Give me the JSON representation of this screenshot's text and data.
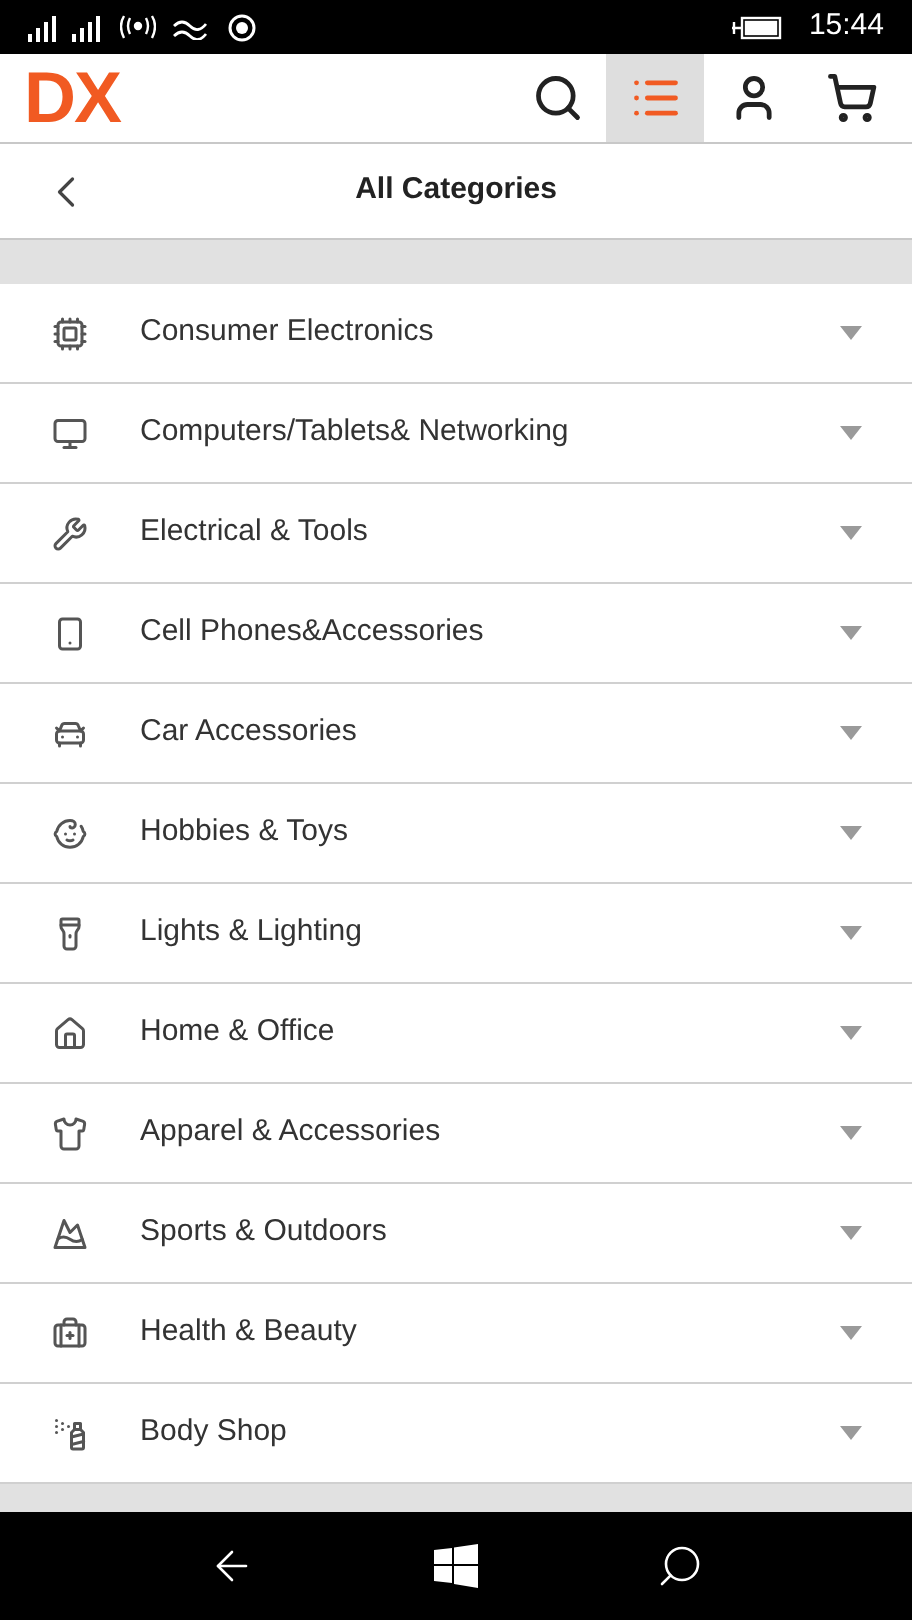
{
  "status_bar": {
    "time": "15:44"
  },
  "header": {
    "logo": "DX",
    "buttons": [
      {
        "kind": "search",
        "selected": false
      },
      {
        "kind": "categories",
        "selected": true
      },
      {
        "kind": "account",
        "selected": false
      },
      {
        "kind": "cart",
        "selected": false
      }
    ]
  },
  "title_bar": {
    "title": "All Categories"
  },
  "categories": [
    {
      "kind": "chip",
      "label": "Consumer Electronics",
      "expanded": false
    },
    {
      "kind": "monitor",
      "label": "Computers/Tablets& Networking",
      "expanded": false
    },
    {
      "kind": "tools",
      "label": "Electrical & Tools",
      "expanded": false
    },
    {
      "kind": "phone",
      "label": "Cell Phones&Accessories",
      "expanded": false
    },
    {
      "kind": "car",
      "label": "Car Accessories",
      "expanded": false
    },
    {
      "kind": "toy",
      "label": "Hobbies & Toys",
      "expanded": false
    },
    {
      "kind": "flashlight",
      "label": "Lights & Lighting",
      "expanded": false
    },
    {
      "kind": "home",
      "label": "Home & Office",
      "expanded": false
    },
    {
      "kind": "shirt",
      "label": "Apparel & Accessories",
      "expanded": false
    },
    {
      "kind": "sports",
      "label": "Sports & Outdoors",
      "expanded": false
    },
    {
      "kind": "health",
      "label": "Health & Beauty",
      "expanded": false
    },
    {
      "kind": "cosmetics",
      "label": "Body Shop",
      "expanded": false
    }
  ]
}
